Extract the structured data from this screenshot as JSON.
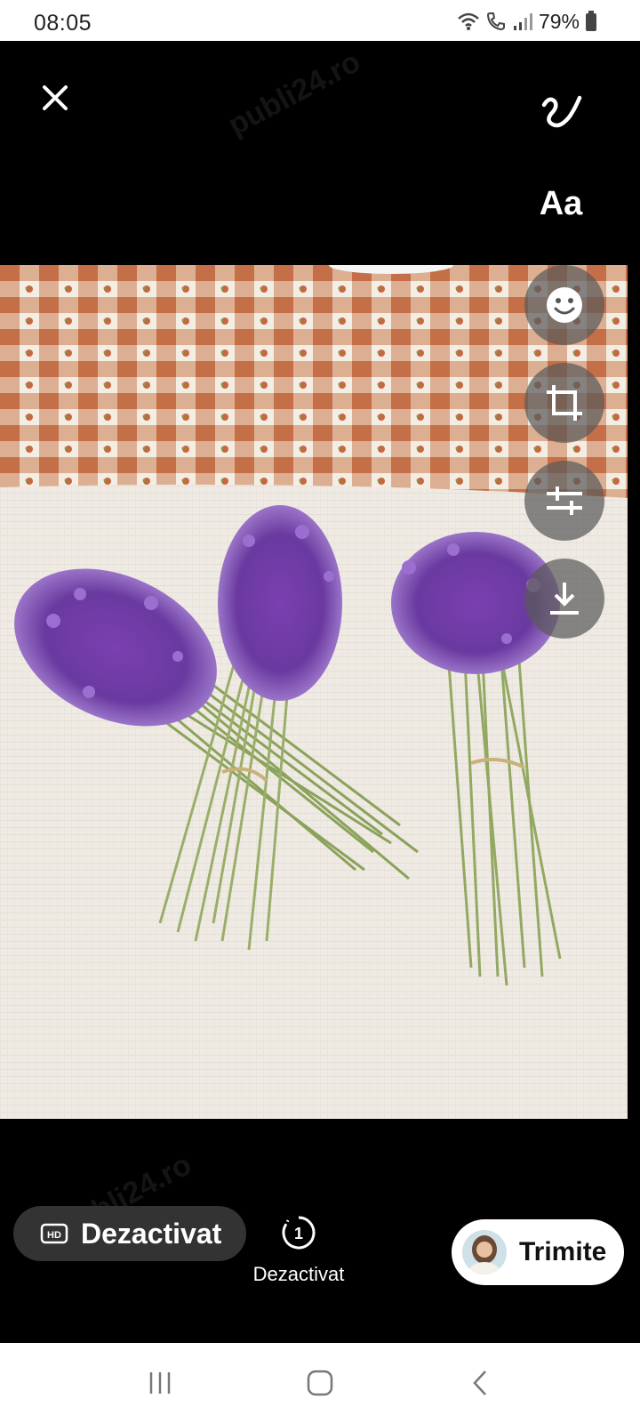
{
  "status_bar": {
    "time": "08:05",
    "battery": "79%",
    "icons": [
      "wifi-icon",
      "call-icon",
      "signal-icon",
      "battery-icon"
    ]
  },
  "editor": {
    "top_tools": [
      "close-icon",
      "draw-icon"
    ],
    "text_tool_label": "Aa",
    "side_tools": [
      "sticker-icon",
      "crop-icon",
      "adjust-icon",
      "download-icon"
    ],
    "watermark": "publi24.ro"
  },
  "bottom": {
    "hd_label": "Dezactivat",
    "timer_label": "Dezactivat",
    "timer_digit": "1",
    "send_label": "Trimite"
  },
  "nav": {
    "items": [
      "recent-apps-icon",
      "home-icon",
      "back-icon"
    ]
  },
  "colors": {
    "accent_bg": "#000000",
    "pill_bg": "#333333",
    "send_bg": "#ffffff"
  }
}
